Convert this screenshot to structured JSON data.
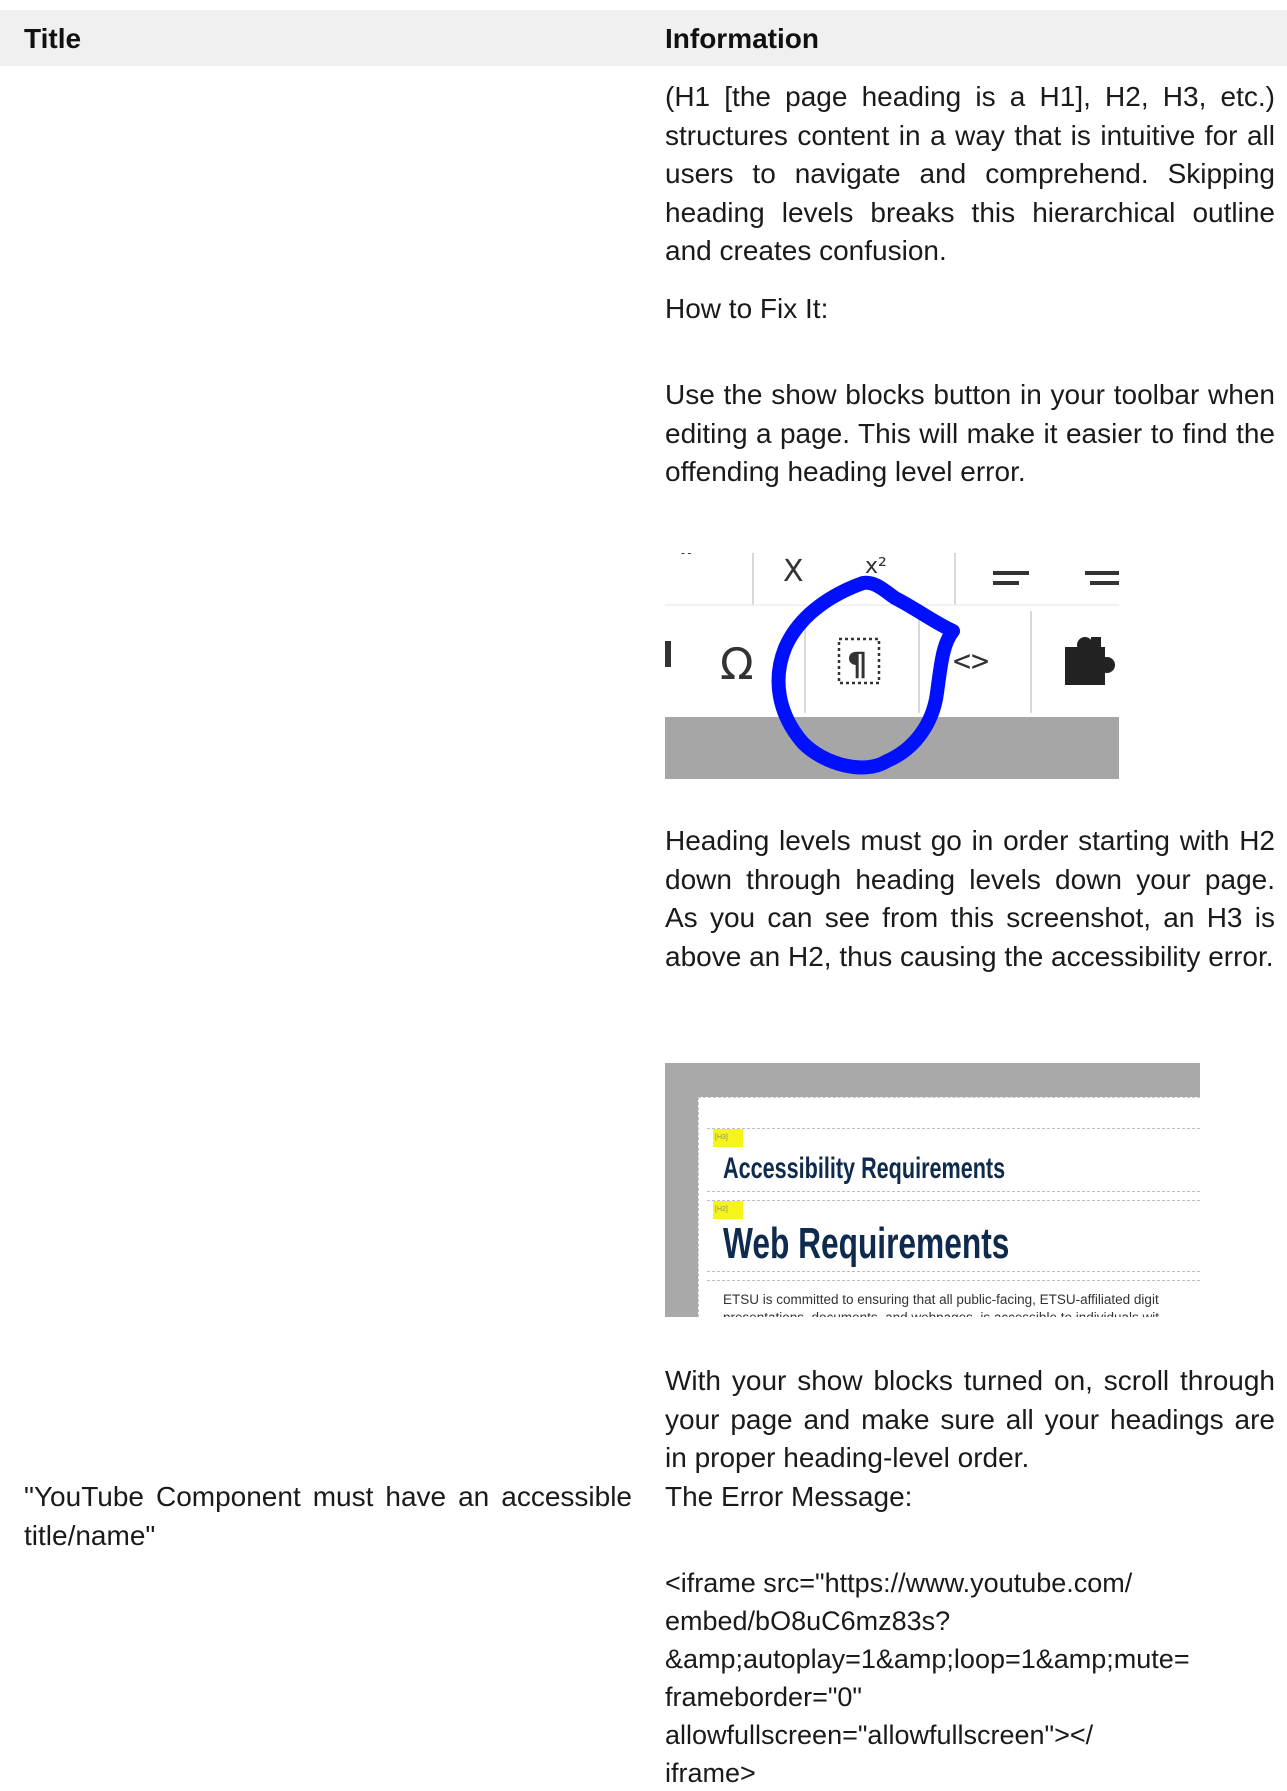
{
  "table": {
    "header": {
      "title": "Title",
      "information": "Information"
    },
    "rows": [
      {
        "title": "",
        "info": {
          "intro_paragraph": "(H1 [the page heading is a H1], H2, H3, etc.) structures content in a way that is intuitive for all users to navigate and comprehend. Skipping heading levels breaks this hierarchical outline and creates confusion.",
          "how_to_fix_label": "How to Fix It:",
          "show_blocks_paragraph": "Use the show blocks button in your toolbar when editing a page. This will make it easier to find the offending heading level error.",
          "toolbar_image": {
            "top_row_glyphs": [
              "”",
              "X",
              "X²",
              "≡",
              "≡"
            ],
            "bottom_row_glyphs": [
              "▐",
              "Ω",
              "¶",
              "<>",
              "puzzle"
            ],
            "circle_color": "#0010ff"
          },
          "order_paragraph": "Heading levels must go in order starting with H2 down through heading levels down your page. As you can see from this screenshot, an H3 is above an H2, thus causing the accessibility error.",
          "editor_image": {
            "h3_text": "Accessibility Requirements",
            "h2_text": "Web Requirements",
            "h3_tag": "[H3]",
            "h2_tag": "[H2]",
            "body_line_1": "ETSU is committed to ensuring that all public-facing, ETSU-affiliated digit",
            "body_line_2": "presentations, documents, and webpages, is accessible to individuals wit",
            "highlight_color": "#f5f51a",
            "heading_color": "#0e2a4d"
          },
          "final_paragraph": "With your show blocks turned on, scroll through your page and make sure all your headings are in proper heading-level order."
        }
      },
      {
        "title": "\"YouTube Component must have an accessible title/name\"",
        "info": {
          "error_message_label": "The Error Message:",
          "code_lines": [
            "<iframe        src=\"https://www.youtube.com/",
            "embed/bO8uC6mz83s?",
            "&amp;autoplay=1&amp;loop=1&amp;mute=",
            "frameborder=\"0\"",
            "allowfullscreen=\"allowfullscreen\"></",
            "iframe>"
          ]
        }
      }
    ]
  }
}
